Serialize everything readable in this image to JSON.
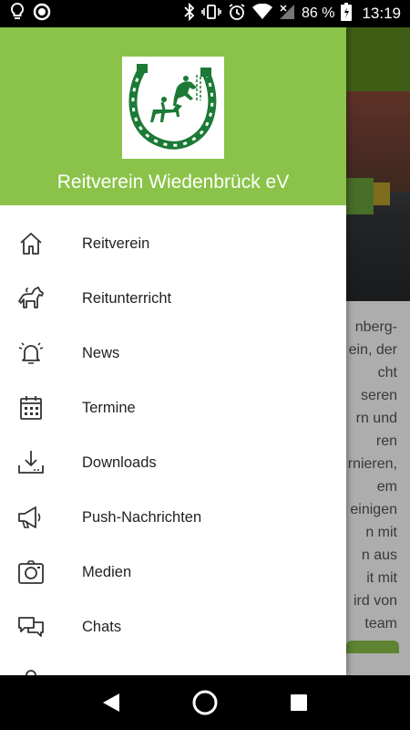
{
  "status_bar": {
    "battery_percent": "86 %",
    "time": "13:19",
    "icons": [
      "lightbulb-icon",
      "record-icon",
      "bluetooth-icon",
      "vibrate-icon",
      "alarm-icon",
      "wifi-icon",
      "signal-icon",
      "battery-icon"
    ]
  },
  "drawer": {
    "title": "Reitverein Wiedenbrück eV",
    "header_color": "#8bc34a",
    "logo": "horseshoe-logo",
    "items": [
      {
        "label": "Reitverein",
        "icon": "home-icon"
      },
      {
        "label": "Reitunterricht",
        "icon": "horse-icon"
      },
      {
        "label": "News",
        "icon": "bell-icon"
      },
      {
        "label": "Termine",
        "icon": "calendar-icon"
      },
      {
        "label": "Downloads",
        "icon": "download-icon"
      },
      {
        "label": "Push-Nachrichten",
        "icon": "megaphone-icon"
      },
      {
        "label": "Medien",
        "icon": "camera-icon"
      },
      {
        "label": "Chats",
        "icon": "chat-icon"
      }
    ]
  },
  "background": {
    "header_color": "#5d8a1f",
    "text_fragments": [
      "nberg-",
      "ein, der",
      "cht",
      "seren",
      "rn und",
      "ren",
      "rnieren,",
      "em",
      "einigen",
      "n mit",
      "n aus",
      "it mit",
      "ird von",
      "team"
    ]
  },
  "navbar": {
    "icons": [
      "back-icon",
      "home-circle-icon",
      "recents-icon"
    ]
  }
}
